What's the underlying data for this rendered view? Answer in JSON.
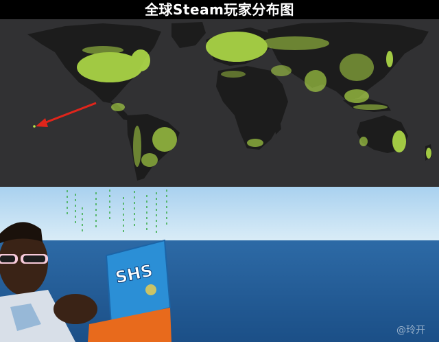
{
  "title": "全球Steam玩家分布图",
  "watermark": "@玲开",
  "laptop_logo": "SHS",
  "colors": {
    "map_background": "#313133",
    "land": "#1c1c1c",
    "player_dots": "#b9e84a",
    "arrow": "#e0251b",
    "sky": "#c4e0f2",
    "ocean": "#2a6fb0",
    "laptop": "#2b8fd6"
  }
}
